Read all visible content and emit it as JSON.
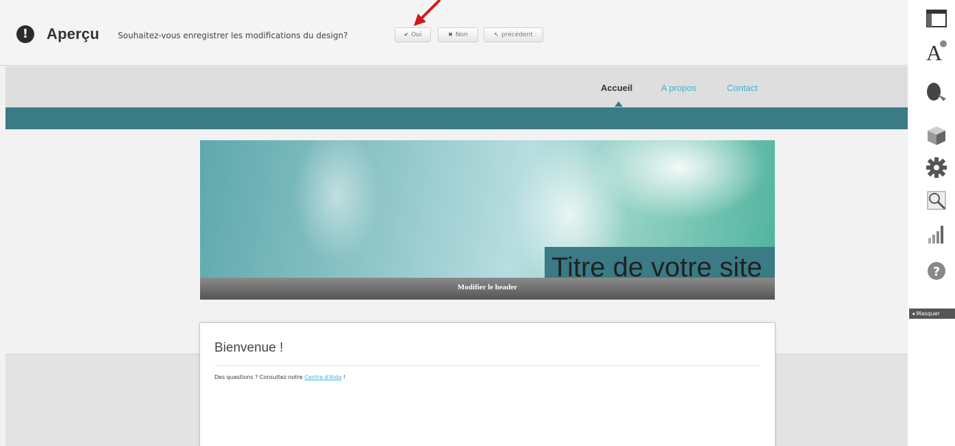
{
  "topbar": {
    "title": "Aperçu",
    "question": "Souhaitez-vous enregistrer les modifications du design?",
    "warn_icon": "!",
    "buttons": {
      "oui": {
        "glyph": "✔",
        "label": "Oui"
      },
      "non": {
        "glyph": "✖",
        "label": "Non"
      },
      "precedent": {
        "glyph": "↖",
        "label": "précédent"
      }
    }
  },
  "nav": {
    "items": [
      {
        "label": "Accueil",
        "active": true
      },
      {
        "label": "A propos",
        "active": false
      },
      {
        "label": "Contact",
        "active": false
      }
    ]
  },
  "banner": {
    "site_title": "Titre de votre site",
    "edit_header_label": "Modifier le header"
  },
  "content": {
    "heading": "Bienvenue !",
    "paragraph_prefix": "Des questions ? Consultez notre ",
    "help_link": "Centre d'Aide",
    "paragraph_suffix": " !"
  },
  "right_toolbar": {
    "icons": [
      "layout-icon",
      "font-icon",
      "theme-icon",
      "module-icon",
      "settings-icon",
      "seo-icon",
      "stats-icon",
      "help-icon"
    ],
    "hide_label": "◂ Masquer"
  },
  "colors": {
    "accent_teal": "#3a7b85",
    "link_blue": "#3ab4d0",
    "annotation_red": "#d11a1a"
  }
}
